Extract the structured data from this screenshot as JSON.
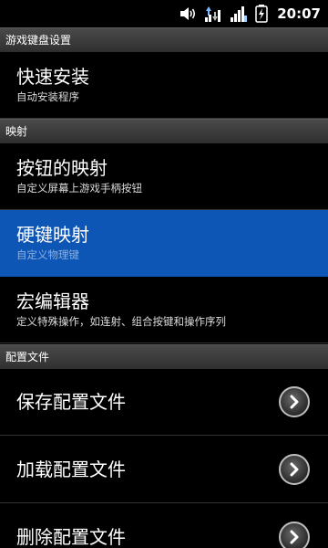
{
  "status_bar": {
    "time": "20:07",
    "icons": [
      "volume-icon",
      "data-transfer-icon",
      "signal-icon",
      "battery-charging-icon"
    ]
  },
  "sections": [
    {
      "header": "游戏键盘设置"
    },
    {
      "header": "映射"
    },
    {
      "header": "配置文件"
    }
  ],
  "items": {
    "quick_install": {
      "title": "快速安装",
      "summary": "自动安装程序"
    },
    "button_mapping": {
      "title": "按钮的映射",
      "summary": "自定义屏幕上游戏手柄按钮"
    },
    "hard_key_mapping": {
      "title": "硬键映射",
      "summary": "自定义物理键"
    },
    "macro_editor": {
      "title": "宏编辑器",
      "summary": "定义特殊操作，如连射、组合按键和操作序列"
    },
    "save_config": {
      "title": "保存配置文件"
    },
    "load_config": {
      "title": "加载配置文件"
    },
    "delete_config": {
      "title": "删除配置文件"
    }
  },
  "colors": {
    "selected": "#0d56b5",
    "header_bg": "#3a3a3a",
    "background": "#000000"
  }
}
